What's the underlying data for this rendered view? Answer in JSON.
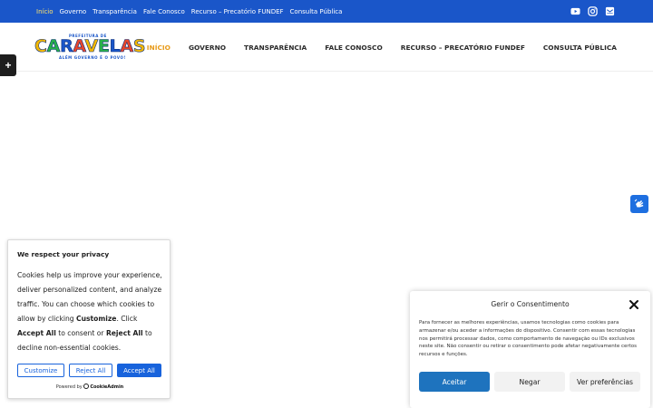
{
  "topbar": {
    "links": [
      {
        "label": "Início",
        "active": true
      },
      {
        "label": "Governo",
        "active": false
      },
      {
        "label": "Transparência",
        "active": false
      },
      {
        "label": "Fale Conosco",
        "active": false
      },
      {
        "label": "Recurso – Precatório FUNDEF",
        "active": false
      },
      {
        "label": "Consulta Pública",
        "active": false
      }
    ],
    "social_icons": [
      "youtube-icon",
      "instagram-icon",
      "email-icon"
    ],
    "background": "#1a56c9"
  },
  "logo": {
    "top_text": "PREFEITURA DE",
    "name": "CARAVELAS",
    "tagline": "ALÉM GOVERNO É O POVO!"
  },
  "mainnav": {
    "items": [
      {
        "label": "INÍCIO",
        "active": true
      },
      {
        "label": "GOVERNO",
        "active": false
      },
      {
        "label": "TRANSPARÊNCIA",
        "active": false
      },
      {
        "label": "FALE CONOSCO",
        "active": false
      },
      {
        "label": "RECURSO – PRECATÓRIO FUNDEF",
        "active": false
      },
      {
        "label": "CONSULTA PÚBLICA",
        "active": false
      }
    ],
    "active_color": "#e89b1b"
  },
  "sidetab": {
    "symbol": "+"
  },
  "cookie_banner": {
    "title": "We respect your privacy",
    "body_1": "Cookies help us improve your experience, deliver personalized content, and analyze traffic. You can choose which cookies to allow by clicking ",
    "body_customize": "Customize",
    "body_2": ". Click ",
    "body_accept": "Accept All",
    "body_3": " to consent or ",
    "body_reject": "Reject All",
    "body_4": " to decline non-essential cookies.",
    "customize_label": "Customize",
    "reject_label": "Reject All",
    "accept_label": "Accept All",
    "powered_by": "Powered by",
    "brand": "CookieAdmin",
    "accent": "#1863dc"
  },
  "consent_panel": {
    "title": "Gerir o Consentimento",
    "text": "Para fornecer as melhores experiências, usamos tecnologias como cookies para armazenar e/ou aceder a informações do dispositivo. Consentir com essas tecnologias nos permitirá processar dados, como comportamento de navegação ou IDs exclusivos neste site. Não consentir ou retirar o consentimento pode afetar negativamente certos recursos e funções.",
    "accept_label": "Aceitar",
    "deny_label": "Negar",
    "prefs_label": "Ver preferências",
    "accent": "#1e73be"
  }
}
